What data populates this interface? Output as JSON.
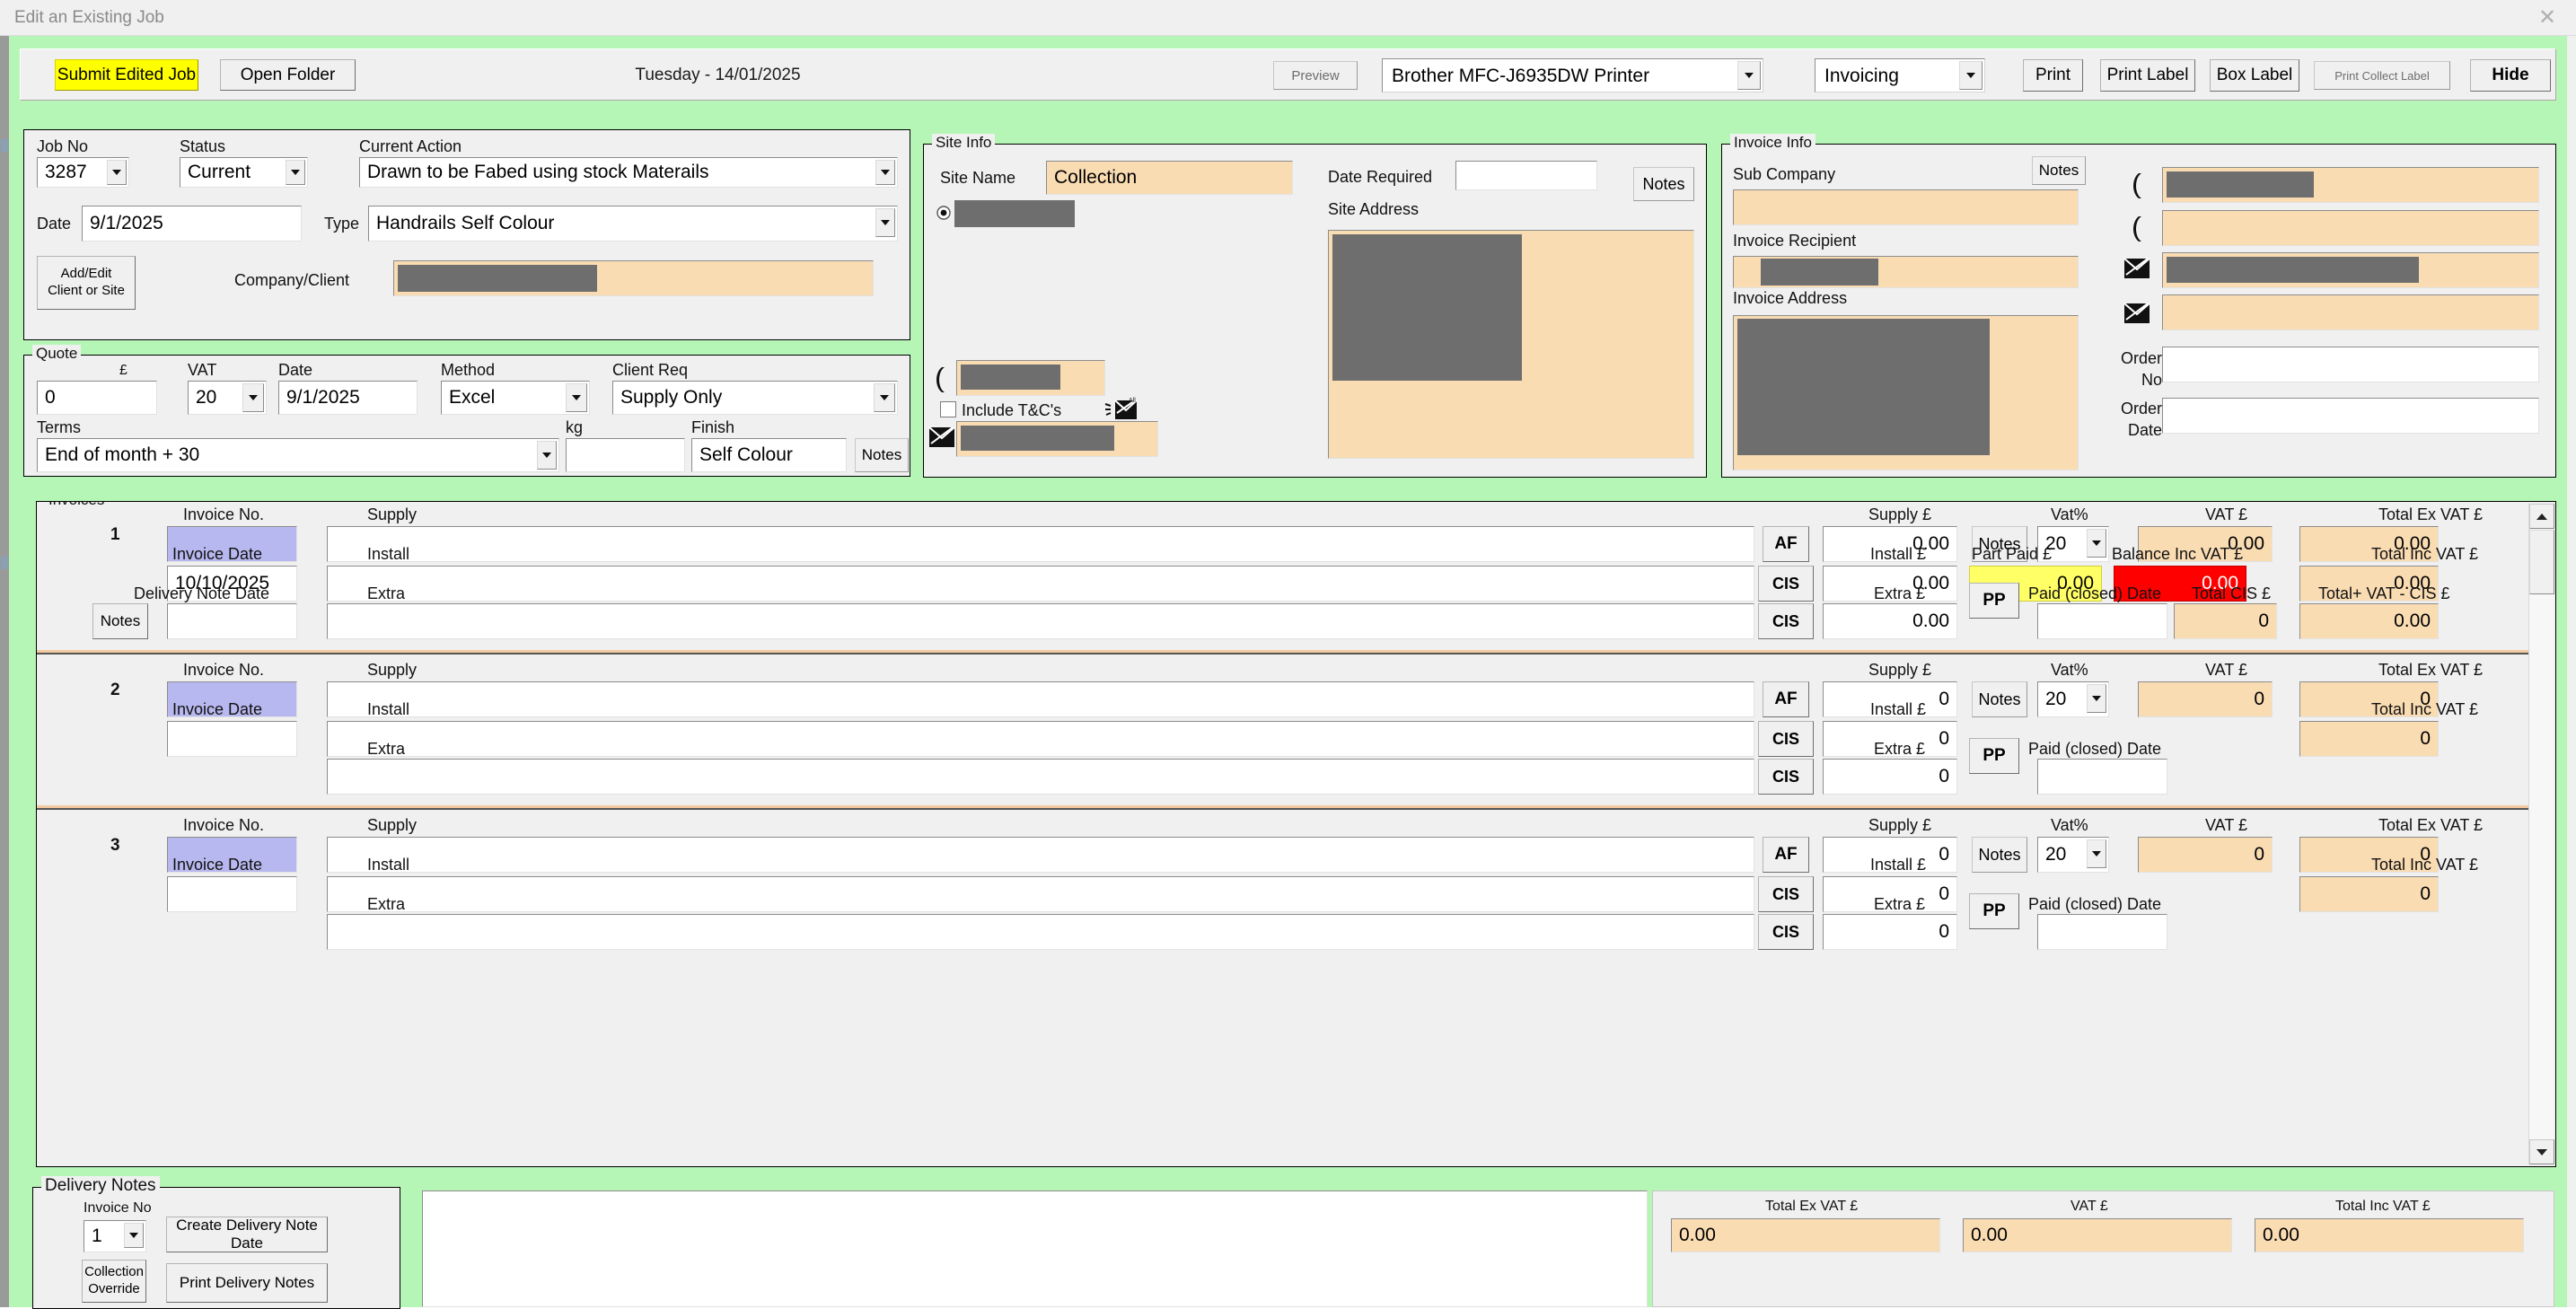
{
  "window": {
    "title": "Edit an Existing Job",
    "close_icon": "close-icon"
  },
  "toolbar": {
    "submit_label": "Submit Edited Job",
    "open_folder_label": "Open Folder",
    "today_date": "Tuesday - 14/01/2025",
    "preview_label": "Preview",
    "printer_value": "Brother MFC-J6935DW Printer",
    "mode_value": "Invoicing",
    "print_label": "Print",
    "print_label_label": "Print Label",
    "box_label_label": "Box Label",
    "print_collect_label": "Print Collect Label",
    "hide_label": "Hide"
  },
  "job": {
    "job_no_label": "Job No",
    "job_no_value": "3287",
    "status_label": "Status",
    "status_value": "Current",
    "current_action_label": "Current Action",
    "current_action_value": "Drawn to be Fabed using stock Materails",
    "date_label": "Date",
    "date_value": "9/1/2025",
    "type_label": "Type",
    "type_value": "Handrails Self Colour",
    "add_edit_line1": "Add/Edit",
    "add_edit_line2": "Client or Site",
    "company_client_label": "Company/Client",
    "company_client_value": ""
  },
  "quote": {
    "legend": "Quote",
    "pound_label": "£",
    "amount_value": "0",
    "vat_label": "VAT",
    "vat_value": "20",
    "date_label": "Date",
    "date_value": "9/1/2025",
    "method_label": "Method",
    "method_value": "Excel",
    "client_req_label": "Client Req",
    "client_req_value": "Supply Only",
    "terms_label": "Terms",
    "terms_value": "End of month + 30",
    "kg_label": "kg",
    "kg_value": "",
    "finish_label": "Finish",
    "finish_value": "Self Colour",
    "notes_label": "Notes"
  },
  "site_info": {
    "legend": "Site Info",
    "site_name_label": "Site Name",
    "site_name_value": "Collection",
    "date_required_label": "Date Required",
    "date_required_value": "",
    "site_address_label": "Site Address",
    "site_address_value": "",
    "notes_label": "Notes",
    "include_tcs_label": "Include T&C's",
    "include_tcs_checked": false,
    "phone_icon": "phone-icon",
    "email_icon": "email-icon",
    "email_all_icon": "email-all-icon",
    "radio_selected": true
  },
  "invoice_info": {
    "legend": "Invoice Info",
    "sub_company_label": "Sub Company",
    "sub_company_value": "",
    "notes_label": "Notes",
    "invoice_recipient_label": "Invoice Recipient",
    "invoice_recipient_value": "",
    "invoice_address_label": "Invoice Address",
    "invoice_address_value": "",
    "order_no_label_line1": "Order",
    "order_no_label_line2": "No",
    "order_no_value": "",
    "order_date_label_line1": "Order",
    "order_date_label_line2": "Date",
    "order_date_value": "",
    "contacts": [
      {
        "icon": "phone-icon",
        "value": ""
      },
      {
        "icon": "phone-icon",
        "value": ""
      },
      {
        "icon": "email-icon",
        "value": ""
      },
      {
        "icon": "email-icon",
        "value": ""
      }
    ]
  },
  "invoices": {
    "legend": "Invoices",
    "headers": {
      "invoice_no": "Invoice No.",
      "supply": "Supply",
      "supply_pound": "Supply £",
      "vat_pct": "Vat%",
      "vat_pound": "VAT £",
      "total_ex_vat": "Total Ex VAT £",
      "invoice_date": "Invoice Date",
      "install": "Install",
      "install_pound": "Install £",
      "part_paid": "Part Paid £",
      "balance_inc_vat": "Balance Inc VAT £",
      "total_inc_vat": "Total Inc VAT £",
      "delivery_note_date": "Delivery Note Date",
      "extra": "Extra",
      "extra_pound": "Extra £",
      "paid_closed_date": "Paid (closed) Date",
      "total_cis": "Total  CIS £",
      "total_vat_minus_cis": "Total+ VAT - CIS £"
    },
    "buttons": {
      "af": "AF",
      "cis": "CIS",
      "pp": "PP",
      "notes": "Notes"
    },
    "rows": [
      {
        "index": "1",
        "invoice_no": "",
        "supply_text": "",
        "supply_amount": "0.00",
        "vat_pct": "20",
        "vat_amount": "0.00",
        "total_ex_vat": "0.00",
        "invoice_date": "10/10/2025",
        "install_text": "",
        "install_amount": "0.00",
        "part_paid": "0.00",
        "balance_inc_vat": "0.00",
        "total_inc_vat": "0.00",
        "delivery_note_date": "",
        "extra_text": "",
        "extra_amount": "0.00",
        "paid_closed_date": "",
        "total_cis": "0",
        "total_vat_minus_cis": "0.00",
        "full": true
      },
      {
        "index": "2",
        "invoice_no": "",
        "supply_text": "",
        "supply_amount": "0",
        "vat_pct": "20",
        "vat_amount": "0",
        "total_ex_vat": "0",
        "invoice_date": "",
        "install_text": "",
        "install_amount": "0",
        "total_inc_vat": "0",
        "extra_text": "",
        "extra_amount": "0",
        "paid_closed_date": "",
        "full": false
      },
      {
        "index": "3",
        "invoice_no": "",
        "supply_text": "",
        "supply_amount": "0",
        "vat_pct": "20",
        "vat_amount": "0",
        "total_ex_vat": "0",
        "invoice_date": "",
        "install_text": "",
        "install_amount": "0",
        "total_inc_vat": "0",
        "extra_text": "",
        "extra_amount": "0",
        "paid_closed_date": "",
        "full": false
      }
    ]
  },
  "delivery_notes": {
    "legend": "Delivery Notes",
    "invoice_no_label": "Invoice No",
    "invoice_no_value": "1",
    "create_label": "Create Delivery Note Date",
    "collection_override_line1": "Collection",
    "collection_override_line2": "Override",
    "print_label": "Print Delivery Notes"
  },
  "notes_box": {
    "value": ""
  },
  "totals": {
    "total_ex_vat_label": "Total Ex VAT £",
    "total_ex_vat_value": "0.00",
    "vat_label": "VAT £",
    "vat_value": "0.00",
    "total_inc_vat_label": "Total Inc VAT £",
    "total_inc_vat_value": "0.00"
  },
  "colors": {
    "client_bg": "#b5f5b5",
    "panel_bg": "#f0f0f0",
    "peach": "#fadcb3",
    "highlight_yellow": "#ffff00",
    "balance_red": "#ff0000",
    "invoice_no_lilac": "#b8b8f0",
    "redact_grey": "#6e6e6e"
  }
}
